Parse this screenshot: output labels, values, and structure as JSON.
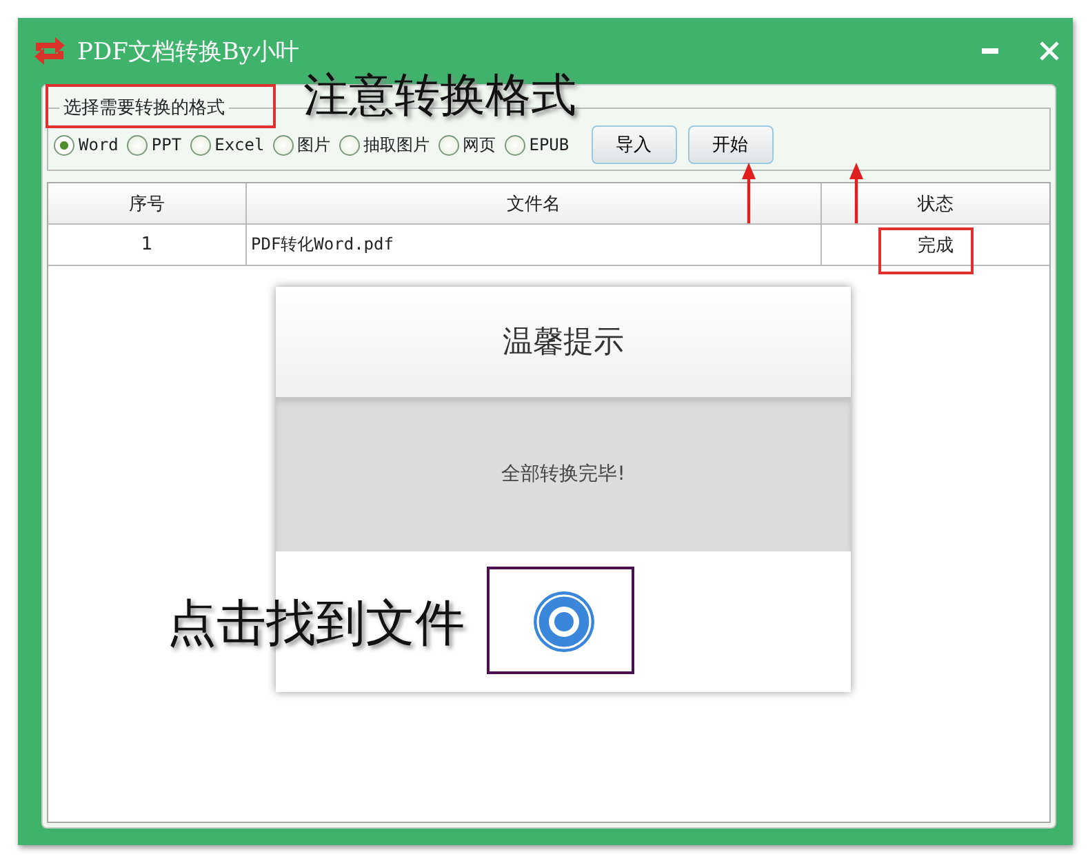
{
  "window": {
    "title": "PDF文档转换By小叶"
  },
  "format_group": {
    "legend": "选择需要转换的格式",
    "options": [
      {
        "label": "Word",
        "selected": true
      },
      {
        "label": "PPT",
        "selected": false
      },
      {
        "label": "Excel",
        "selected": false
      },
      {
        "label": "图片",
        "selected": false
      },
      {
        "label": "抽取图片",
        "selected": false
      },
      {
        "label": "网页",
        "selected": false
      },
      {
        "label": "EPUB",
        "selected": false
      }
    ]
  },
  "buttons": [
    "导入",
    "开始"
  ],
  "table": {
    "columns": [
      "序号",
      "文件名",
      "状态"
    ],
    "rows": [
      {
        "index": "1",
        "file": "PDF转化Word.pdf",
        "status": "完成"
      }
    ]
  },
  "dialog": {
    "title": "温馨提示",
    "message": "全部转换完毕!"
  },
  "annotations": [
    "注意转换格式",
    "点击找到文件"
  ]
}
